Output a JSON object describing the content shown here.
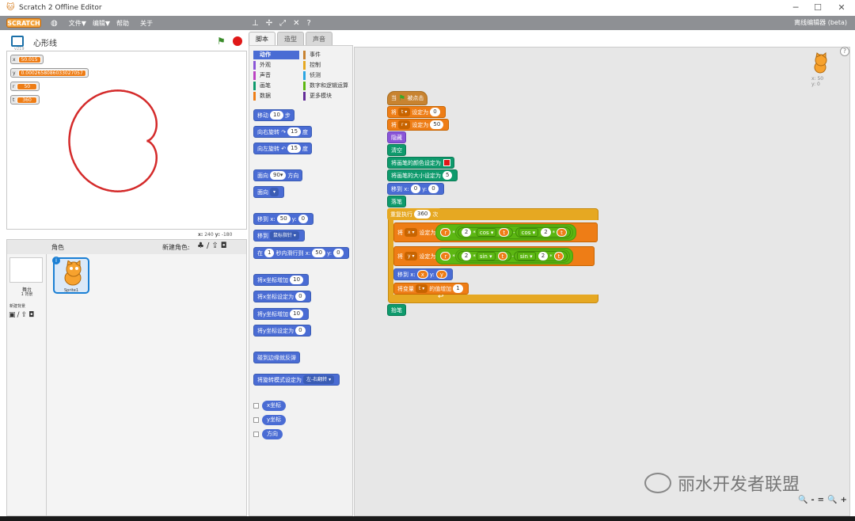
{
  "window": {
    "title": "Scratch 2 Offline Editor",
    "minimize": "─",
    "maximize": "☐",
    "close": "✕"
  },
  "menubar": {
    "logo": "SCRATCH",
    "items": [
      "文件▼",
      "编辑▼",
      "帮助",
      "关于"
    ],
    "offline_label": "离线编辑器 (beta)",
    "tool_icons": [
      "stamp-icon",
      "cut-icon",
      "grow-icon",
      "shrink-icon",
      "help-icon"
    ]
  },
  "stage": {
    "project_name": "心形线",
    "version": "v219",
    "monitors": [
      {
        "name": "x",
        "value": "50.015"
      },
      {
        "name": "y",
        "value": "0.0002658086033027057"
      },
      {
        "name": "r",
        "value": "50"
      },
      {
        "name": "t",
        "value": "360"
      }
    ],
    "mouse_x_label": "x:",
    "mouse_x": "240",
    "mouse_y_label": "y:",
    "mouse_y": "-180",
    "drawing_color": "#d42a2a"
  },
  "sprites": {
    "header_label": "角色",
    "new_sprite_label": "新建角色:",
    "stage_name": "舞台",
    "stage_bg_count": "1 背景",
    "new_backdrop_label": "新建背景",
    "sprite_name": "Sprite1"
  },
  "tabs": [
    "脚本",
    "造型",
    "声音"
  ],
  "palette": {
    "categories": [
      {
        "label": "动作",
        "color": "#4a6cd4"
      },
      {
        "label": "事件",
        "color": "#c88330"
      },
      {
        "label": "外观",
        "color": "#8a55d7"
      },
      {
        "label": "控制",
        "color": "#e6a822"
      },
      {
        "label": "声音",
        "color": "#bb42c3"
      },
      {
        "label": "侦测",
        "color": "#2ca5e2"
      },
      {
        "label": "画笔",
        "color": "#0e9a6c"
      },
      {
        "label": "数字和逻辑运算",
        "color": "#5cb712"
      },
      {
        "label": "数据",
        "color": "#ee7d16"
      },
      {
        "label": "更多模块",
        "color": "#632d99"
      }
    ],
    "blocks": {
      "move": {
        "pre": "移动",
        "val": "10",
        "post": "步"
      },
      "turn_right": {
        "pre": "向右旋转",
        "icon": "↷",
        "val": "15",
        "post": "度"
      },
      "turn_left": {
        "pre": "向左旋转",
        "icon": "↶",
        "val": "15",
        "post": "度"
      },
      "point_dir": {
        "pre": "面向",
        "val": "90▾",
        "post": "方向"
      },
      "point_towards": {
        "pre": "面向",
        "val": "▾"
      },
      "goto_xy": {
        "pre": "移到 x:",
        "x": "50",
        "ylabel": "y:",
        "y": "0"
      },
      "goto_target": {
        "pre": "移到",
        "val": "鼠标指针 ▾"
      },
      "glide": {
        "pre": "在",
        "secs": "1",
        "mid": "秒内滑行到 x:",
        "x": "50",
        "ylabel": "y:",
        "y": "0"
      },
      "change_x": {
        "pre": "将x坐标增加",
        "val": "10"
      },
      "set_x": {
        "pre": "将x坐标设定为",
        "val": "0"
      },
      "change_y": {
        "pre": "将y坐标增加",
        "val": "10"
      },
      "set_y": {
        "pre": "将y坐标设定为",
        "val": "0"
      },
      "bounce": {
        "pre": "碰到边缘就反弹"
      },
      "rotation_style": {
        "pre": "将旋转模式设定为",
        "val": "左-右翻转 ▾"
      },
      "reporters": [
        "x坐标",
        "y坐标",
        "方向"
      ]
    }
  },
  "script": {
    "hat": {
      "pre": "当",
      "post": "被点击"
    },
    "set_t": {
      "pre": "将",
      "var": "t ▾",
      "mid": "设定为",
      "val": "0"
    },
    "set_r": {
      "pre": "将",
      "var": "r ▾",
      "mid": "设定为",
      "val": "50"
    },
    "hide": "隐藏",
    "clear": "清空",
    "pen_color": "将画笔的颜色设定为",
    "pen_color_value": "#e01818",
    "pen_size": {
      "pre": "将画笔的大小设定为",
      "val": "5"
    },
    "goto": {
      "pre": "移到 x:",
      "x": "0",
      "ylabel": "y:",
      "y": "0"
    },
    "pen_down": "落笔",
    "repeat": {
      "pre": "重复执行",
      "val": "360",
      "post": "次"
    },
    "set_x_expr": {
      "pre": "将",
      "var": "x ▾",
      "mid": "设定为",
      "r": "r",
      "times": "*",
      "two": "2",
      "fn1": "cos ▾",
      "t": "t",
      "minus": "-",
      "fn2": "cos ▾"
    },
    "set_y_expr": {
      "pre": "将",
      "var": "y ▾",
      "mid": "设定为",
      "r": "r",
      "times": "*",
      "two": "2",
      "fn1": "sin ▾",
      "t": "t",
      "minus": "-",
      "fn2": "sin ▾"
    },
    "move_xy": {
      "pre": "移到 x:",
      "x": "x",
      "ylabel": "y:",
      "y": "y"
    },
    "change_t": {
      "pre": "将变量",
      "var": "t ▾",
      "mid": "的值增加",
      "val": "1"
    },
    "loop_arrow": "↩",
    "pen_up": "抬笔"
  },
  "script_area": {
    "corner_x": "x: 50",
    "corner_y": "y: 0",
    "help": "?",
    "zoom": [
      "🔍-",
      "=",
      "🔍+"
    ]
  },
  "watermark": "丽水开发者联盟"
}
